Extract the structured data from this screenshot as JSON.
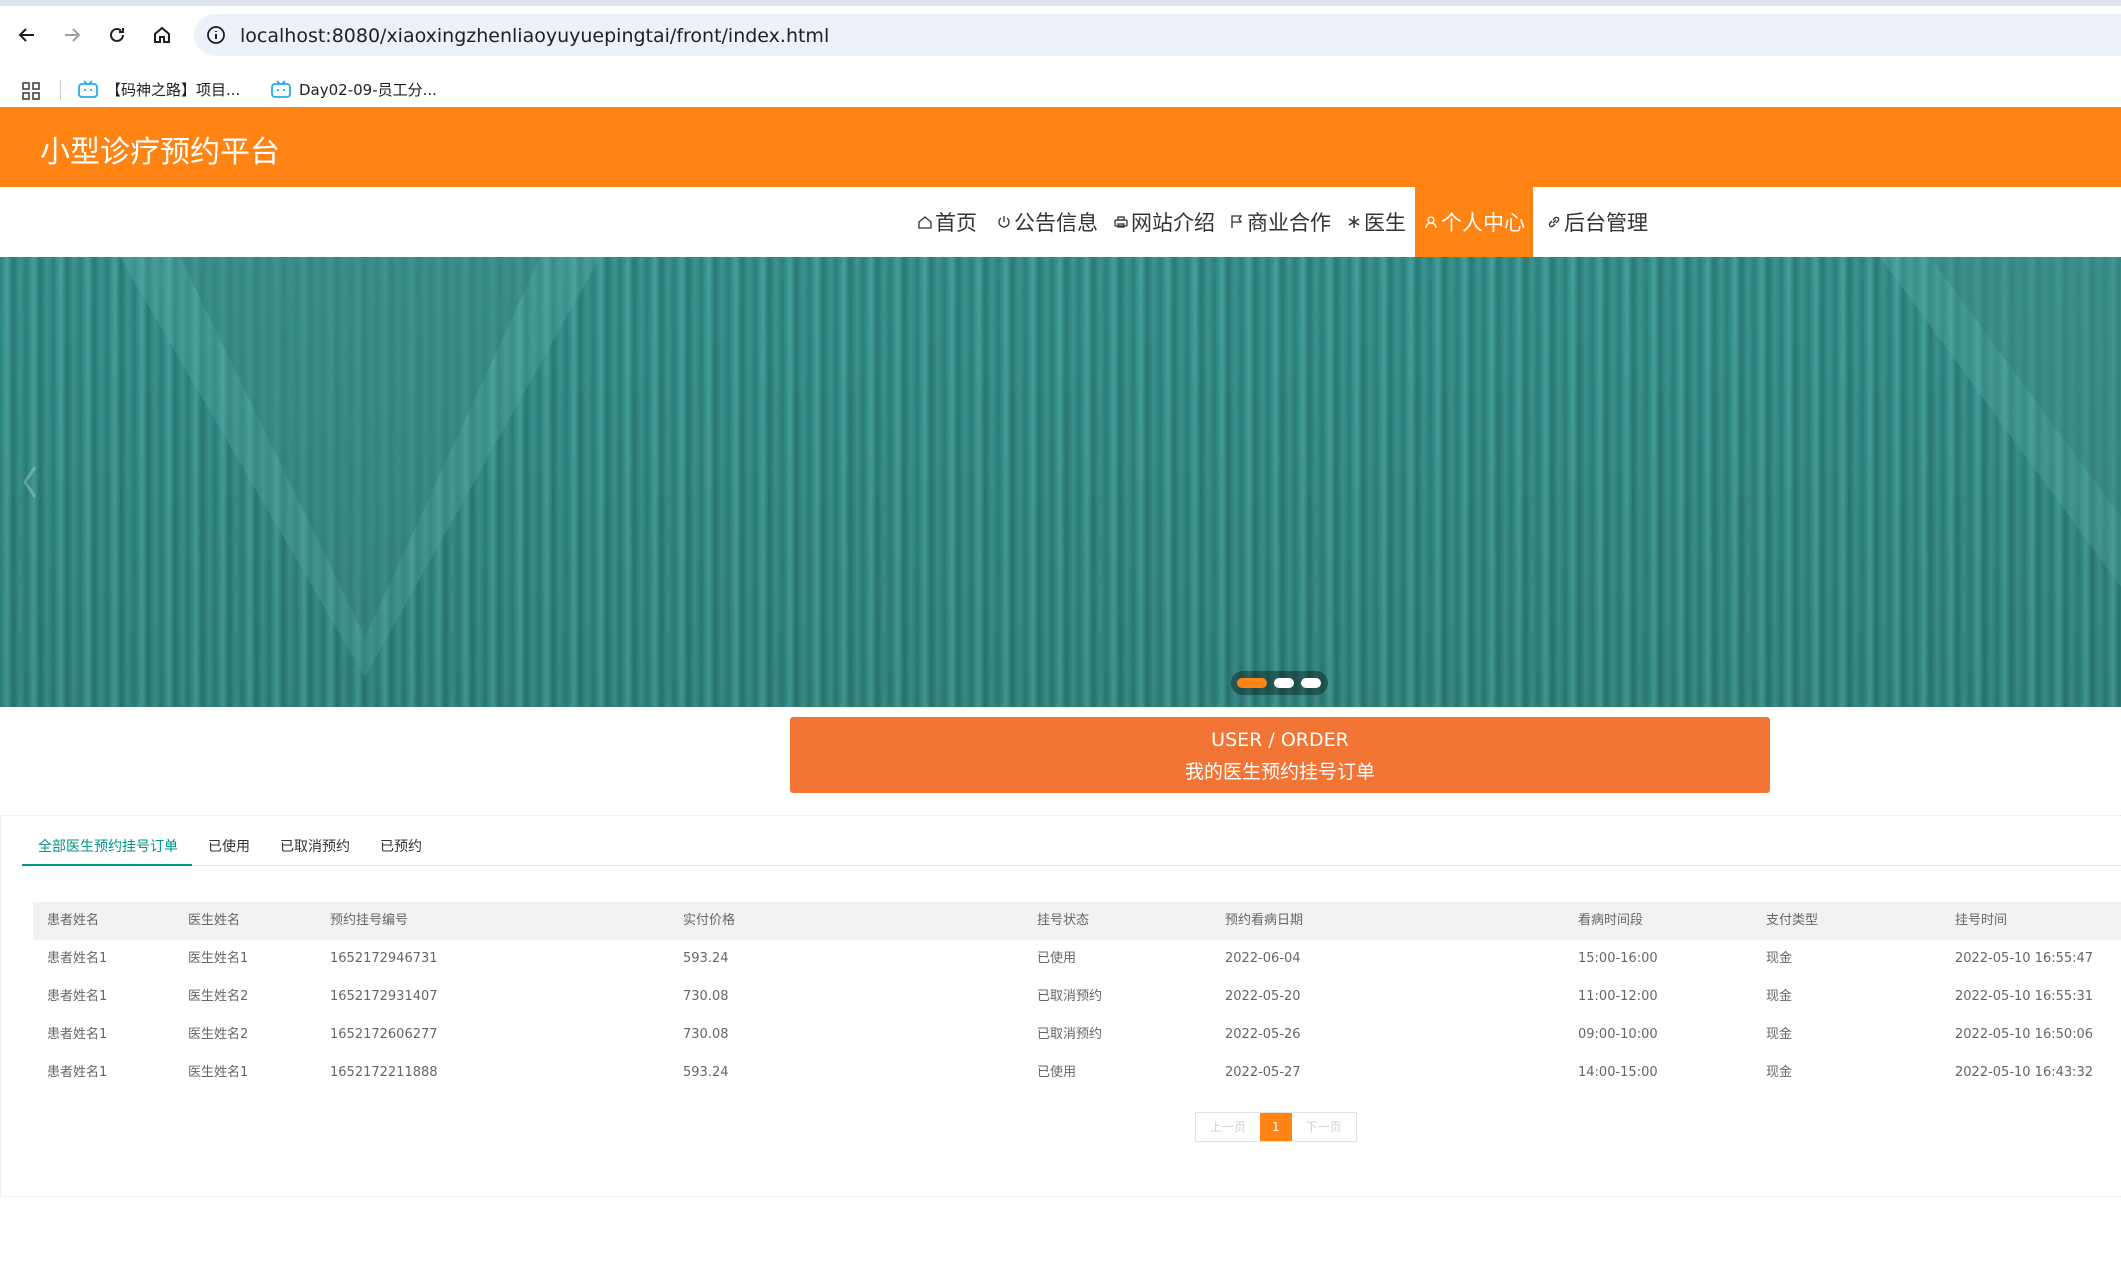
{
  "browser": {
    "url": "localhost:8080/xiaoxingzhenliaoyuyuepingtai/front/index.html",
    "bookmarks": [
      {
        "label": "【码神之路】项目..."
      },
      {
        "label": "Day02-09-员工分..."
      }
    ]
  },
  "header": {
    "site_title": "小型诊疗预约平台"
  },
  "nav": {
    "items": [
      {
        "label": "首页",
        "icon": "home-icon"
      },
      {
        "label": "公告信息",
        "icon": "power-icon"
      },
      {
        "label": "网站介绍",
        "icon": "print-icon"
      },
      {
        "label": "商业合作",
        "icon": "flag-icon"
      },
      {
        "label": "医生",
        "icon": "snowflake-icon"
      },
      {
        "label": "个人中心",
        "icon": "user-icon",
        "active": true
      },
      {
        "label": "后台管理",
        "icon": "link-icon"
      }
    ]
  },
  "banner": {
    "slides_total": 3,
    "active_slide": 1
  },
  "section_title": {
    "en": "USER / ORDER",
    "cn": "我的医生预约挂号订单"
  },
  "tabs": [
    {
      "label": "全部医生预约挂号订单",
      "active": true
    },
    {
      "label": "已使用"
    },
    {
      "label": "已取消预约"
    },
    {
      "label": "已预约"
    }
  ],
  "table": {
    "columns": [
      "患者姓名",
      "医生姓名",
      "预约挂号编号",
      "实付价格",
      "挂号状态",
      "预约看病日期",
      "看病时间段",
      "支付类型",
      "挂号时间"
    ],
    "rows": [
      [
        "患者姓名1",
        "医生姓名1",
        "1652172946731",
        "593.24",
        "已使用",
        "2022-06-04",
        "15:00-16:00",
        "现金",
        "2022-05-10 16:55:47"
      ],
      [
        "患者姓名1",
        "医生姓名2",
        "1652172931407",
        "730.08",
        "已取消预约",
        "2022-05-20",
        "11:00-12:00",
        "现金",
        "2022-05-10 16:55:31"
      ],
      [
        "患者姓名1",
        "医生姓名2",
        "1652172606277",
        "730.08",
        "已取消预约",
        "2022-05-26",
        "09:00-10:00",
        "现金",
        "2022-05-10 16:50:06"
      ],
      [
        "患者姓名1",
        "医生姓名1",
        "1652172211888",
        "593.24",
        "已使用",
        "2022-05-27",
        "14:00-15:00",
        "现金",
        "2022-05-10 16:43:32"
      ]
    ]
  },
  "pagination": {
    "prev": "上一页",
    "current": "1",
    "next": "下一页"
  },
  "colors": {
    "brand_orange": "#ff8413",
    "title_box": "#f27535",
    "tab_active": "#009688",
    "banner_teal": "#3a9893"
  }
}
